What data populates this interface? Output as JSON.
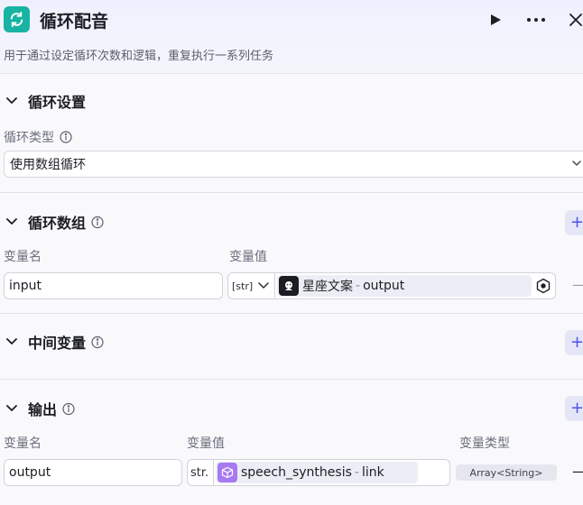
{
  "header": {
    "title": "循环配音",
    "description": "用于通过设定循环次数和逻辑，重复执行一系列任务"
  },
  "loop_settings": {
    "title": "循环设置",
    "type_label": "循环类型",
    "type_value": "使用数组循环"
  },
  "loop_array": {
    "title": "循环数组",
    "col_name": "变量名",
    "col_value": "变量值",
    "row": {
      "name": "input",
      "type_tag": "[str]",
      "node_name": "星座文案",
      "separator": "-",
      "field": "output"
    }
  },
  "intermediate": {
    "title": "中间变量"
  },
  "output": {
    "title": "输出",
    "col_name": "变量名",
    "col_value": "变量值",
    "col_type": "变量类型",
    "row": {
      "name": "output",
      "type_tag": "str.",
      "node_name": "speech_synthesis",
      "separator": "-",
      "field": "link",
      "var_type": "Array<String>"
    }
  },
  "common": {
    "plus": "+",
    "minus": "—"
  },
  "colors": {
    "accent": "#4d53e8",
    "app_icon": "#19b3a3",
    "node_purple": "#a879f0"
  }
}
